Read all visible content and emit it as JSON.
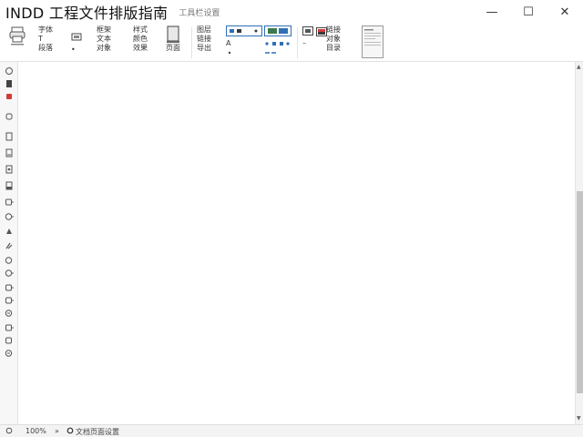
{
  "window": {
    "title": "INDD 工程文件排版指南",
    "subtitle": "工具栏设置",
    "minimize": "—",
    "maximize": "☐",
    "close": "✕"
  },
  "ribbon": {
    "g1": {
      "label_top": "",
      "label_bottom": ""
    },
    "g2": {
      "line1": "字体",
      "line2": "T",
      "line3": "段落"
    },
    "g3": {
      "line1": "",
      "line2": ""
    },
    "g4": {
      "line1": "框架",
      "line2": "文本",
      "line3": "对象"
    },
    "g5": {
      "line1": "样式",
      "line2": "颜色",
      "line3": "效果"
    },
    "g6": {
      "label": "页面"
    },
    "g7": {
      "line1": "图层",
      "line2": "链接",
      "line3": "导出"
    },
    "g8": {
      "line1": "A",
      "line2": ""
    },
    "g10": {
      "line1": "链接",
      "line2": "对象",
      "line3": "目录"
    }
  },
  "status": {
    "zoom": "100%",
    "sep": "»",
    "page_info": "文档页面设置"
  },
  "colors": {
    "accent": "#2f6fb5",
    "red": "#d23a3a",
    "dark": "#3b3b3b"
  }
}
